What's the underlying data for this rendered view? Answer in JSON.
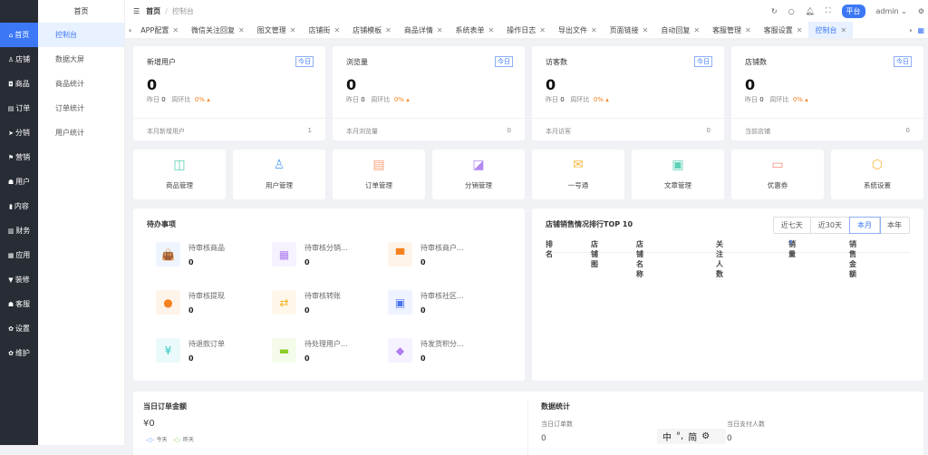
{
  "sidebar": {
    "items": [
      {
        "label": "首页",
        "icon": "⌂"
      },
      {
        "label": "店铺",
        "icon": "♙"
      },
      {
        "label": "商品",
        "icon": "◘"
      },
      {
        "label": "订单",
        "icon": "▤"
      },
      {
        "label": "分销",
        "icon": "➤"
      },
      {
        "label": "营销",
        "icon": "⚑"
      },
      {
        "label": "用户",
        "icon": "☗"
      },
      {
        "label": "内容",
        "icon": "▮"
      },
      {
        "label": "财务",
        "icon": "▥"
      },
      {
        "label": "应用",
        "icon": "▦"
      },
      {
        "label": "装修",
        "icon": "▼"
      },
      {
        "label": "客服",
        "icon": "☗"
      },
      {
        "label": "设置",
        "icon": "✿"
      },
      {
        "label": "维护",
        "icon": "✿"
      }
    ]
  },
  "submenu": {
    "title": "首页",
    "items": [
      "控制台",
      "数据大屏",
      "商品统计",
      "订单统计",
      "用户统计"
    ]
  },
  "header": {
    "breadcrumb_root": "首页",
    "breadcrumb_sep": "/",
    "breadcrumb_current": "控制台",
    "platform": "平台",
    "user": "admin"
  },
  "tabs": [
    "APP配置",
    "微信关注回复",
    "图文管理",
    "店铺街",
    "店铺模板",
    "商品详情",
    "系统表单",
    "操作日志",
    "导出文件",
    "页面链接",
    "自动回复",
    "客服管理",
    "客服设置",
    "控制台"
  ],
  "stats": [
    {
      "title": "新增用户",
      "badge": "今日",
      "value": "0",
      "yesterday_label": "昨日",
      "yesterday": "0",
      "wow_label": "周环比",
      "wow": "0%",
      "foot_label": "本月新增用户",
      "foot_value": "1"
    },
    {
      "title": "浏览量",
      "badge": "今日",
      "value": "0",
      "yesterday_label": "昨日",
      "yesterday": "0",
      "wow_label": "周环比",
      "wow": "0%",
      "foot_label": "本月浏览量",
      "foot_value": "0"
    },
    {
      "title": "访客数",
      "badge": "今日",
      "value": "0",
      "yesterday_label": "昨日",
      "yesterday": "0",
      "wow_label": "周环比",
      "wow": "0%",
      "foot_label": "本月访客",
      "foot_value": "0"
    },
    {
      "title": "店铺数",
      "badge": "今日",
      "value": "0",
      "yesterday_label": "昨日",
      "yesterday": "0",
      "wow_label": "周环比",
      "wow": "0%",
      "foot_label": "当前店铺",
      "foot_value": "0"
    }
  ],
  "shortcuts": [
    {
      "label": "商品管理",
      "color": "#5fcfb8",
      "icon": "◫"
    },
    {
      "label": "用户管理",
      "color": "#5aa6f8",
      "icon": "♙"
    },
    {
      "label": "订单管理",
      "color": "#f7a07a",
      "icon": "▤"
    },
    {
      "label": "分销管理",
      "color": "#b38af0",
      "icon": "◪"
    },
    {
      "label": "一号通",
      "color": "#f5b63a",
      "icon": "✉"
    },
    {
      "label": "文章管理",
      "color": "#5fcfb8",
      "icon": "▣"
    },
    {
      "label": "优惠券",
      "color": "#f7907a",
      "icon": "▭"
    },
    {
      "label": "系统设置",
      "color": "#f5b63a",
      "icon": "⬡"
    }
  ],
  "todo": {
    "title": "待办事项",
    "items": [
      {
        "label": "待审核商品",
        "value": "0",
        "icon": "👜",
        "bg": "#eef5ff",
        "fg": "#3c8cf6"
      },
      {
        "label": "待审核分销...",
        "value": "0",
        "icon": "▦",
        "bg": "#f6f2ff",
        "fg": "#b07ef0"
      },
      {
        "label": "待审核商户...",
        "value": "0",
        "icon": "▀",
        "bg": "#fff4ea",
        "fg": "#f5821f"
      },
      {
        "label": "待审核提现",
        "value": "0",
        "icon": "●",
        "bg": "#fff4ea",
        "fg": "#f5821f"
      },
      {
        "label": "待审核转账",
        "value": "0",
        "icon": "⇄",
        "bg": "#fff8ea",
        "fg": "#f5b020"
      },
      {
        "label": "待审核社区...",
        "value": "0",
        "icon": "▣",
        "bg": "#eef3ff",
        "fg": "#4a72f0"
      },
      {
        "label": "待退款订单",
        "value": "0",
        "icon": "¥",
        "bg": "#eafafa",
        "fg": "#2cc5c0"
      },
      {
        "label": "待处理用户...",
        "value": "0",
        "icon": "▬",
        "bg": "#f4fbea",
        "fg": "#8ccc2a"
      },
      {
        "label": "待发货积分...",
        "value": "0",
        "icon": "◆",
        "bg": "#f6f2ff",
        "fg": "#b07ef0"
      }
    ]
  },
  "ranking": {
    "title": "店铺销售情况排行TOP 10",
    "ranges": [
      "近七天",
      "近30天",
      "本月",
      "本年"
    ],
    "active_range": "本月",
    "columns": [
      "排名",
      "店铺图",
      "店铺名称",
      "关注人数",
      "销量",
      "销售金额"
    ]
  },
  "bottom": {
    "order_title": "当日订单金额",
    "order_amount": "¥0",
    "legend_today": "今天",
    "legend_yesterday": "昨天",
    "data_title": "数据统计",
    "orders_label": "当日订单数",
    "orders_value": "0",
    "payers_label": "当日支付人数",
    "payers_value": "0"
  },
  "ime": {
    "lang": "中",
    "punct": "°,",
    "mode": "简"
  }
}
